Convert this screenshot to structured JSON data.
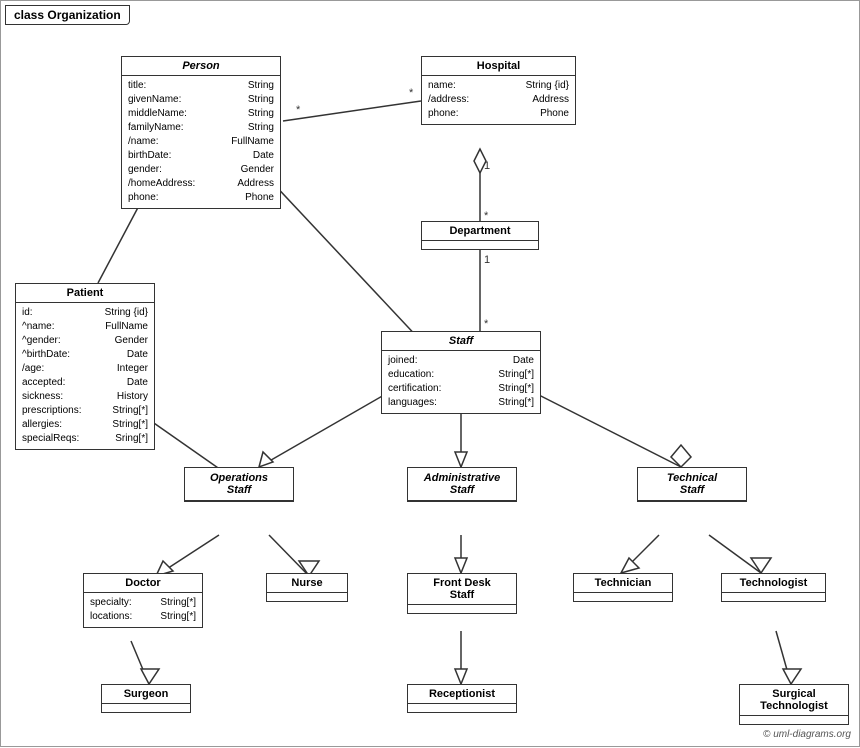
{
  "title": "class Organization",
  "classes": {
    "person": {
      "name": "Person",
      "italic": true,
      "attrs": [
        {
          "name": "title:",
          "type": "String"
        },
        {
          "name": "givenName:",
          "type": "String"
        },
        {
          "name": "middleName:",
          "type": "String"
        },
        {
          "name": "familyName:",
          "type": "String"
        },
        {
          "name": "/name:",
          "type": "FullName"
        },
        {
          "name": "birthDate:",
          "type": "Date"
        },
        {
          "name": "gender:",
          "type": "Gender"
        },
        {
          "name": "/homeAddress:",
          "type": "Address"
        },
        {
          "name": "phone:",
          "type": "Phone"
        }
      ]
    },
    "hospital": {
      "name": "Hospital",
      "italic": false,
      "attrs": [
        {
          "name": "name:",
          "type": "String {id}"
        },
        {
          "name": "/address:",
          "type": "Address"
        },
        {
          "name": "phone:",
          "type": "Phone"
        }
      ]
    },
    "department": {
      "name": "Department",
      "italic": false,
      "attrs": []
    },
    "staff": {
      "name": "Staff",
      "italic": true,
      "attrs": [
        {
          "name": "joined:",
          "type": "Date"
        },
        {
          "name": "education:",
          "type": "String[*]"
        },
        {
          "name": "certification:",
          "type": "String[*]"
        },
        {
          "name": "languages:",
          "type": "String[*]"
        }
      ]
    },
    "patient": {
      "name": "Patient",
      "italic": false,
      "attrs": [
        {
          "name": "id:",
          "type": "String {id}"
        },
        {
          "name": "^name:",
          "type": "FullName"
        },
        {
          "name": "^gender:",
          "type": "Gender"
        },
        {
          "name": "^birthDate:",
          "type": "Date"
        },
        {
          "name": "/age:",
          "type": "Integer"
        },
        {
          "name": "accepted:",
          "type": "Date"
        },
        {
          "name": "sickness:",
          "type": "History"
        },
        {
          "name": "prescriptions:",
          "type": "String[*]"
        },
        {
          "name": "allergies:",
          "type": "String[*]"
        },
        {
          "name": "specialReqs:",
          "type": "Sring[*]"
        }
      ]
    },
    "operations_staff": {
      "name": "Operations Staff",
      "italic": true
    },
    "administrative_staff": {
      "name": "Administrative Staff",
      "italic": true
    },
    "technical_staff": {
      "name": "Technical Staff",
      "italic": true
    },
    "doctor": {
      "name": "Doctor",
      "italic": false,
      "attrs": [
        {
          "name": "specialty:",
          "type": "String[*]"
        },
        {
          "name": "locations:",
          "type": "String[*]"
        }
      ]
    },
    "nurse": {
      "name": "Nurse",
      "italic": false,
      "attrs": []
    },
    "front_desk_staff": {
      "name": "Front Desk Staff",
      "italic": false,
      "attrs": []
    },
    "technician": {
      "name": "Technician",
      "italic": false,
      "attrs": []
    },
    "technologist": {
      "name": "Technologist",
      "italic": false,
      "attrs": []
    },
    "surgeon": {
      "name": "Surgeon",
      "italic": false,
      "attrs": []
    },
    "receptionist": {
      "name": "Receptionist",
      "italic": false,
      "attrs": []
    },
    "surgical_technologist": {
      "name": "Surgical Technologist",
      "italic": false,
      "attrs": []
    }
  },
  "copyright": "© uml-diagrams.org"
}
